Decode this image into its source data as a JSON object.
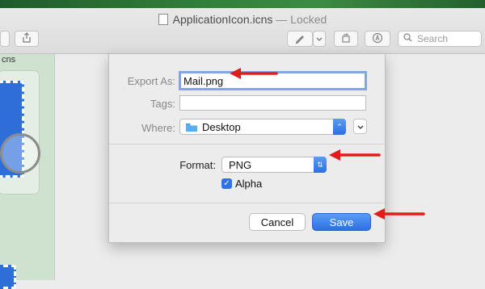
{
  "window": {
    "title": "ApplicationIcon.icns",
    "title_suffix": "— Locked",
    "search_placeholder": "Search"
  },
  "toolbar": {
    "icons": [
      "share-icon",
      "markup-pen-icon",
      "chevron-down-icon",
      "rotate-icon",
      "annotate-icon",
      "search-icon"
    ]
  },
  "sidebar": {
    "label": "cns"
  },
  "dialog": {
    "export_as_label": "Export As:",
    "export_as_value": "Mail.png",
    "tags_label": "Tags:",
    "tags_value": "",
    "where_label": "Where:",
    "where_value": "Desktop",
    "format_label": "Format:",
    "format_value": "PNG",
    "alpha_label": "Alpha",
    "alpha_checked": true,
    "cancel_label": "Cancel",
    "save_label": "Save"
  },
  "colors": {
    "accent": "#2e6fe3",
    "arrow": "#e21b1b"
  }
}
